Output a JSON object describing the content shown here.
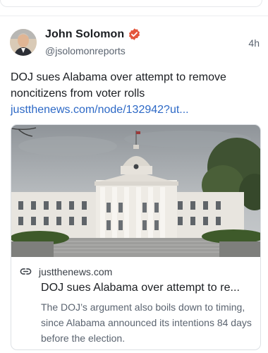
{
  "author": {
    "display_name": "John Solomon",
    "handle": "@jsolomonreports",
    "verified": true,
    "avatar_icon": "avatar"
  },
  "post": {
    "timestamp": "4h",
    "text": "DOJ sues Alabama over attempt to remove noncitizens from voter rolls ",
    "link_text": "justthenews.com/node/132942?ut..."
  },
  "embed": {
    "domain": "justthenews.com",
    "title": "DOJ sues Alabama over attempt to re...",
    "description": "The DOJ’s argument also boils down to timing, since Alabama announced its intentions 84 days before the election.",
    "link_icon": "link-icon"
  },
  "colors": {
    "link": "#2d69c6",
    "verified_badge": "#e4553b",
    "muted_text": "#5b6470"
  }
}
